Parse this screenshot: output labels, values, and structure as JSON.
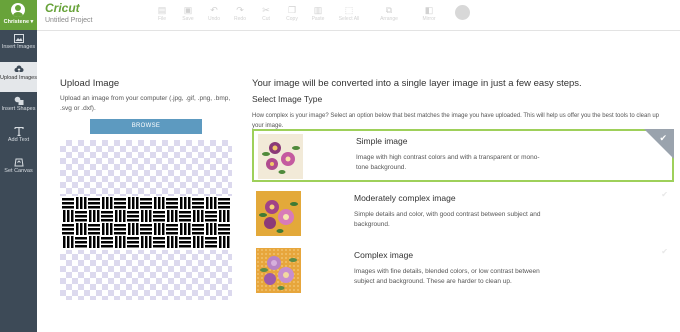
{
  "sidebar": {
    "user_name": "Christene ▾",
    "items": [
      {
        "label": "Insert Images",
        "icon": "image-icon"
      },
      {
        "label": "Upload Images",
        "icon": "cloud-upload-icon"
      },
      {
        "label": "Insert Shapes",
        "icon": "shapes-icon"
      },
      {
        "label": "Add Text",
        "icon": "text-icon"
      },
      {
        "label": "Set Canvas",
        "icon": "canvas-icon"
      }
    ]
  },
  "topbar": {
    "logo": "Cricut",
    "project_name": "Untitled Project",
    "buttons": [
      {
        "label": "File",
        "icon": "file-icon"
      },
      {
        "label": "Save",
        "icon": "save-icon"
      },
      {
        "label": "Undo",
        "icon": "undo-icon"
      },
      {
        "label": "Redo",
        "icon": "redo-icon"
      },
      {
        "label": "Cut",
        "icon": "cut-icon"
      },
      {
        "label": "Copy",
        "icon": "copy-icon"
      },
      {
        "label": "Paste",
        "icon": "paste-icon"
      },
      {
        "label": "Select All",
        "icon": "select-all-icon"
      },
      {
        "label": "Arrange",
        "icon": "arrange-icon"
      },
      {
        "label": "Mirror",
        "icon": "mirror-icon"
      }
    ]
  },
  "upload": {
    "title": "Upload Image",
    "description": "Upload an image from your computer (.jpg, .gif, .png, .bmp, .svg or .dxf).",
    "browse_label": "BROWSE"
  },
  "main": {
    "heading": "Your image will be converted into a single layer image in just a few easy steps.",
    "select_type": "Select Image Type",
    "help_text": "How complex is your image? Select an option below that best matches the image you have uploaded. This will help us offer you the best tools to clean up your image.",
    "options": [
      {
        "title": "Simple image",
        "description": "Image with high contrast colors and with a transparent or mono-tone background.",
        "selected": true
      },
      {
        "title": "Moderately complex image",
        "description": "Simple details and color, with good contrast between subject and background.",
        "selected": false
      },
      {
        "title": "Complex image",
        "description": "Images with fine details, blended colors, or low contrast between subject and background. These are harder to clean up.",
        "selected": false
      }
    ]
  },
  "colors": {
    "brand_green": "#68a33a",
    "sidebar_bg": "#3d4a57",
    "browse_blue": "#5d9ac0",
    "selected_border": "#9ed05a"
  }
}
